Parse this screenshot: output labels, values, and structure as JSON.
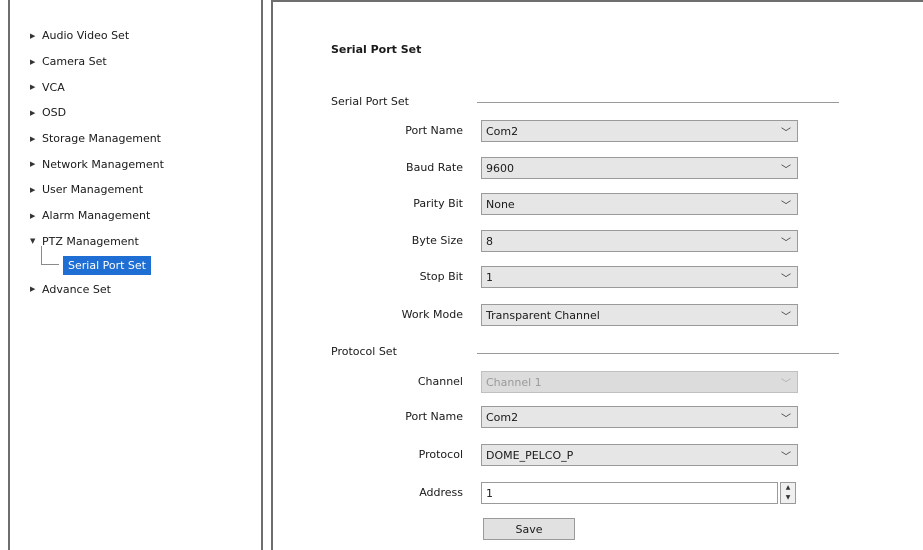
{
  "sidebar": {
    "items": [
      {
        "label": "Audio Video Set",
        "arrow": "▶"
      },
      {
        "label": "Camera Set",
        "arrow": "▶"
      },
      {
        "label": "VCA",
        "arrow": "▶"
      },
      {
        "label": "OSD",
        "arrow": "▶"
      },
      {
        "label": "Storage Management",
        "arrow": "▶"
      },
      {
        "label": "Network Management",
        "arrow": "▶"
      },
      {
        "label": "User Management",
        "arrow": "▶"
      },
      {
        "label": "Alarm Management",
        "arrow": "▶"
      },
      {
        "label": "PTZ Management",
        "arrow": "▼"
      },
      {
        "label": "Advance Set",
        "arrow": "▶"
      }
    ],
    "selected_child": "Serial Port Set"
  },
  "main": {
    "title": "Serial Port Set",
    "serial_section": {
      "label": "Serial Port Set",
      "port_name": {
        "label": "Port Name",
        "value": "Com2"
      },
      "baud_rate": {
        "label": "Baud Rate",
        "value": "9600"
      },
      "parity_bit": {
        "label": "Parity Bit",
        "value": "None"
      },
      "byte_size": {
        "label": "Byte Size",
        "value": "8"
      },
      "stop_bit": {
        "label": "Stop Bit",
        "value": "1"
      },
      "work_mode": {
        "label": "Work Mode",
        "value": "Transparent Channel"
      }
    },
    "protocol_section": {
      "label": "Protocol Set",
      "channel": {
        "label": "Channel",
        "value": "Channel 1"
      },
      "port_name": {
        "label": "Port Name",
        "value": "Com2"
      },
      "protocol": {
        "label": "Protocol",
        "value": "DOME_PELCO_P"
      },
      "address": {
        "label": "Address",
        "value": "1"
      }
    },
    "save_label": "Save"
  },
  "icons": {
    "dropdown": "chevron-down-icon",
    "tree_collapsed": "caret-right-icon",
    "tree_expanded": "caret-down-icon"
  },
  "colors": {
    "selection": "#1f6ed4",
    "combo_bg": "#e6e6e6"
  }
}
